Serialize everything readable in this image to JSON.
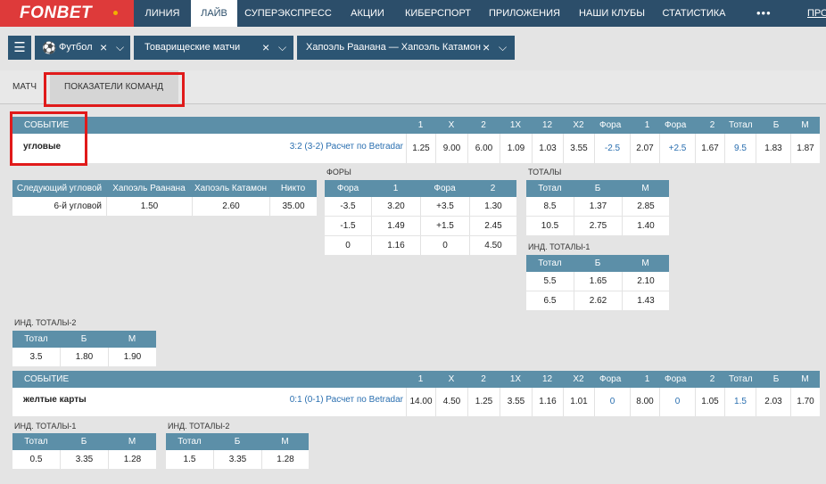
{
  "nav": {
    "logo": "FONBET",
    "items": [
      "ЛИНИЯ",
      "ЛАЙВ",
      "СУПЕРЭКСПРЕСС",
      "АКЦИИ",
      "КИБЕРСПОРТ",
      "ПРИЛОЖЕНИЯ",
      "НАШИ КЛУБЫ",
      "СТАТИСТИКА"
    ],
    "more": "•••",
    "cut": "ПРО"
  },
  "filters": {
    "sport": "Футбол",
    "league": "Товарищеские матчи",
    "match": "Хапоэль Раанана — Хапоэль Катамон"
  },
  "tabs": [
    "МАТЧ",
    "ПОКАЗАТЕЛИ КОМАНД"
  ],
  "header_cols": [
    "СОБЫТИЕ",
    "1",
    "X",
    "2",
    "1X",
    "12",
    "X2",
    "Фора",
    "1",
    "Фора",
    "2",
    "Тотал",
    "Б",
    "М"
  ],
  "event1": {
    "name": "угловые",
    "score": "3:2 (3-2) Расчет по Betradar",
    "odds": [
      "1.25",
      "9.00",
      "6.00",
      "1.09",
      "1.03",
      "3.55",
      "-2.5",
      "2.07",
      "+2.5",
      "1.67",
      "9.5",
      "1.83",
      "1.87"
    ]
  },
  "next_corner": {
    "headers": [
      "Следующий угловой",
      "Хапоэль Раанана",
      "Хапоэль Катамон",
      "Никто"
    ],
    "row": [
      "6-й угловой",
      "1.50",
      "2.60",
      "35.00"
    ]
  },
  "fory": {
    "title": "ФОРЫ",
    "headers": [
      "Фора",
      "1",
      "Фора",
      "2"
    ],
    "rows": [
      [
        "-3.5",
        "3.20",
        "+3.5",
        "1.30"
      ],
      [
        "-1.5",
        "1.49",
        "+1.5",
        "2.45"
      ],
      [
        "0",
        "1.16",
        "0",
        "4.50"
      ]
    ]
  },
  "totals": {
    "title": "ТОТАЛЫ",
    "headers": [
      "Тотал",
      "Б",
      "М"
    ],
    "rows": [
      [
        "8.5",
        "1.37",
        "2.85"
      ],
      [
        "10.5",
        "2.75",
        "1.40"
      ]
    ]
  },
  "ind1": {
    "title": "ИНД. ТОТАЛЫ-1",
    "headers": [
      "Тотал",
      "Б",
      "М"
    ],
    "rows": [
      [
        "5.5",
        "1.65",
        "2.10"
      ],
      [
        "6.5",
        "2.62",
        "1.43"
      ]
    ]
  },
  "ind2": {
    "title": "ИНД. ТОТАЛЫ-2",
    "headers": [
      "Тотал",
      "Б",
      "М"
    ],
    "rows": [
      [
        "3.5",
        "1.80",
        "1.90"
      ]
    ]
  },
  "event2": {
    "name": "желтые карты",
    "score": "0:1 (0-1) Расчет по Betradar",
    "odds": [
      "14.00",
      "4.50",
      "1.25",
      "3.55",
      "1.16",
      "1.01",
      "0",
      "8.00",
      "0",
      "1.05",
      "1.5",
      "2.03",
      "1.70"
    ]
  },
  "cards_ind1": {
    "title": "ИНД. ТОТАЛЫ-1",
    "headers": [
      "Тотал",
      "Б",
      "М"
    ],
    "rows": [
      [
        "0.5",
        "3.35",
        "1.28"
      ]
    ]
  },
  "cards_ind2": {
    "title": "ИНД. ТОТАЛЫ-2",
    "headers": [
      "Тотал",
      "Б",
      "М"
    ],
    "rows": [
      [
        "1.5",
        "3.35",
        "1.28"
      ]
    ]
  }
}
